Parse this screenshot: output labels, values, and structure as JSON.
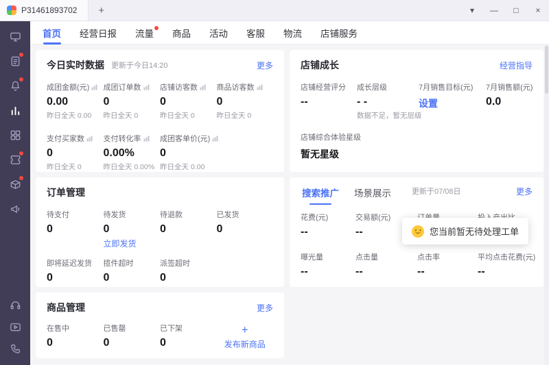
{
  "titlebar": {
    "tab": "P31461893702",
    "new_tab": "+",
    "controls": {
      "collapse": "▾",
      "minimize": "—",
      "maximize": "□",
      "close": "×"
    }
  },
  "nav": {
    "items": [
      {
        "label": "首页",
        "active": true,
        "badge": false
      },
      {
        "label": "经营日报",
        "active": false,
        "badge": false
      },
      {
        "label": "流量",
        "active": false,
        "badge": true
      },
      {
        "label": "商品",
        "active": false,
        "badge": false
      },
      {
        "label": "活动",
        "active": false,
        "badge": false
      },
      {
        "label": "客服",
        "active": false,
        "badge": false
      },
      {
        "label": "物流",
        "active": false,
        "badge": false
      },
      {
        "label": "店铺服务",
        "active": false,
        "badge": false
      }
    ]
  },
  "sidebar": {
    "icons": [
      {
        "name": "workbench-icon",
        "badge": false,
        "active": false
      },
      {
        "name": "orders-icon",
        "badge": true,
        "active": false
      },
      {
        "name": "notifications-icon",
        "badge": true,
        "active": false
      },
      {
        "name": "analytics-icon",
        "badge": false,
        "active": true
      },
      {
        "name": "apps-icon",
        "badge": false,
        "active": false
      },
      {
        "name": "marketing-icon",
        "badge": true,
        "active": false
      },
      {
        "name": "inventory-icon",
        "badge": true,
        "active": false
      },
      {
        "name": "announcement-icon",
        "badge": false,
        "active": false
      }
    ],
    "bottom_icons": [
      "support-icon",
      "video-icon",
      "phone-icon"
    ]
  },
  "cards": {
    "today": {
      "title": "今日实时数据",
      "updated": "更新于今日14:20",
      "more": "更多",
      "metrics": [
        {
          "label": "成团金额(元)",
          "value": "0.00",
          "sub": "昨日全天 0.00"
        },
        {
          "label": "成团订单数",
          "value": "0",
          "sub": "昨日全天 0"
        },
        {
          "label": "店铺访客数",
          "value": "0",
          "sub": "昨日全天 0"
        },
        {
          "label": "商品访客数",
          "value": "0",
          "sub": "昨日全天 0"
        },
        {
          "label": "支付买家数",
          "value": "0",
          "sub": "昨日全天 0"
        },
        {
          "label": "支付转化率",
          "value": "0.00%",
          "sub": "昨日全天 0.00%"
        },
        {
          "label": "成团客单价(元)",
          "value": "0",
          "sub": "昨日全天 0.00"
        }
      ]
    },
    "growth": {
      "title": "店铺成长",
      "link": "经营指导",
      "items": [
        {
          "label": "店铺经营评分",
          "value": "--"
        },
        {
          "label": "成长层级",
          "value": "- -",
          "sub": "数据不足，暂无层级"
        },
        {
          "label": "7月销售目标(元)",
          "action": "设置"
        },
        {
          "label": "7月销售额(元)",
          "value": "0.0"
        }
      ],
      "star_label": "店铺综合体验星级",
      "star_value": "暂无星级"
    },
    "orders": {
      "title": "订单管理",
      "row1": [
        {
          "label": "待支付",
          "value": "0"
        },
        {
          "label": "待发货",
          "value": "0",
          "action": "立即发货"
        },
        {
          "label": "待退款",
          "value": "0"
        },
        {
          "label": "已发货",
          "value": "0"
        }
      ],
      "row2": [
        {
          "label": "即将延迟发货",
          "value": "0"
        },
        {
          "label": "揽件超时",
          "value": "0"
        },
        {
          "label": "派签超时",
          "value": "0"
        }
      ]
    },
    "promo": {
      "tabs": [
        {
          "label": "搜索推广",
          "active": true
        },
        {
          "label": "场景展示",
          "active": false
        }
      ],
      "updated": "更新于07/08日",
      "more": "更多",
      "row1": [
        {
          "label": "花费(元)",
          "value": "--"
        },
        {
          "label": "交易额(元)",
          "value": "--"
        },
        {
          "label": "订单量",
          "value": "--"
        },
        {
          "label": "投入产出比",
          "value": "--"
        }
      ],
      "row2": [
        {
          "label": "曝光量",
          "value": "--"
        },
        {
          "label": "点击量",
          "value": "--"
        },
        {
          "label": "点击率",
          "value": "--"
        },
        {
          "label": "平均点击花费(元)",
          "value": "--"
        }
      ]
    },
    "products": {
      "title": "商品管理",
      "more": "更多",
      "items": [
        {
          "label": "在售中",
          "value": "0"
        },
        {
          "label": "已售罄",
          "value": "0"
        },
        {
          "label": "已下架",
          "value": "0"
        }
      ],
      "publish_plus": "+",
      "publish_label": "发布新商品"
    }
  },
  "tooltip": {
    "text": "您当前暂无待处理工单"
  },
  "colors": {
    "accent_blue": "#4a72f7",
    "badge_red": "#f5493c",
    "sidebar_bg": "#413d56"
  }
}
